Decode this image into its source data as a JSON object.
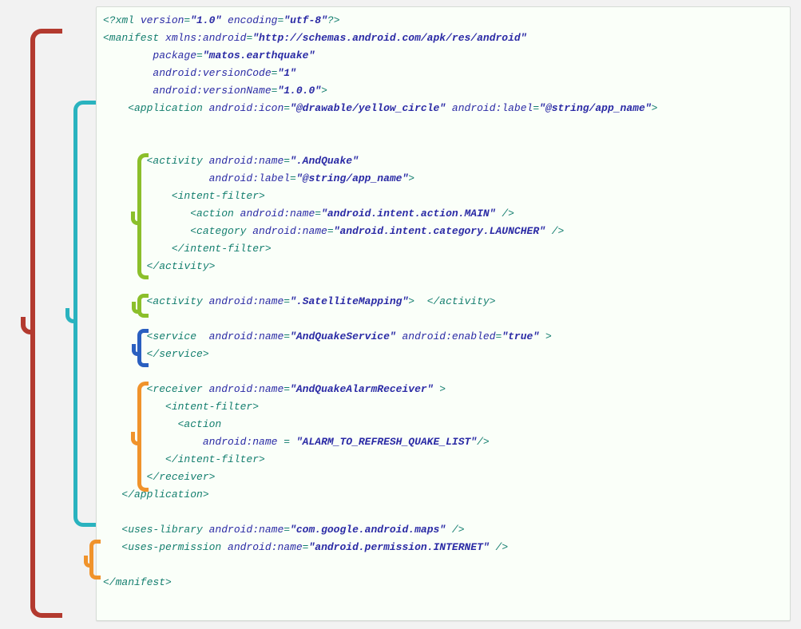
{
  "code": {
    "l01a": "<?xml ",
    "l01b": "version",
    "l01c": "=",
    "l01d": "\"1.0\"",
    "l01e": " encoding",
    "l01f": "=",
    "l01g": "\"utf-8\"",
    "l01h": "?>",
    "l02a": "<manifest ",
    "l02b": "xmlns:android",
    "l02c": "=",
    "l02d": "\"http://schemas.android.com/apk/res/android\"",
    "l03a": "        package",
    "l03b": "=",
    "l03c": "\"matos.earthquake\"",
    "l04a": "        android:versionCode",
    "l04b": "=",
    "l04c": "\"1\"",
    "l05a": "        android:versionName",
    "l05b": "=",
    "l05c": "\"1.0.0\"",
    "l05d": ">",
    "l06a": "    <application ",
    "l06b": "android:icon",
    "l06c": "=",
    "l06d": "\"@drawable/yellow_circle\"",
    "l06e": " android:label",
    "l06f": "=",
    "l06g": "\"@string/app_name\"",
    "l06h": ">",
    "l07blank": "",
    "l08blank": "",
    "l09a": "       <activity ",
    "l09b": "android:name",
    "l09c": "=",
    "l09d": "\".AndQuake\"",
    "l10a": "                 android:label",
    "l10b": "=",
    "l10c": "\"@string/app_name\"",
    "l10d": ">",
    "l11a": "           <intent-filter>",
    "l12a": "              <action ",
    "l12b": "android:name",
    "l12c": "=",
    "l12d": "\"android.intent.action.MAIN\"",
    "l12e": " />",
    "l13a": "              <category ",
    "l13b": "android:name",
    "l13c": "=",
    "l13d": "\"android.intent.category.LAUNCHER\"",
    "l13e": " />",
    "l14a": "           </intent-filter>",
    "l15a": "       </activity>",
    "l16blank": "",
    "l17a": "       <activity ",
    "l17b": "android:name",
    "l17c": "=",
    "l17d": "\".SatelliteMapping\"",
    "l17e": ">  </activity>",
    "l18blank": "",
    "l19a": "       <service  ",
    "l19b": "android:name",
    "l19c": "=",
    "l19d": "\"AndQuakeService\"",
    "l19e": " android:enabled",
    "l19f": "=",
    "l19g": "\"true\"",
    "l19h": " >",
    "l20a": "       </service>",
    "l21blank": "",
    "l22a": "       <receiver ",
    "l22b": "android:name",
    "l22c": "=",
    "l22d": "\"AndQuakeAlarmReceiver\"",
    "l22e": " >",
    "l23a": "          <intent-filter>",
    "l24a": "            <action",
    "l25a": "                android:name ",
    "l25b": "= ",
    "l25c": "\"ALARM_TO_REFRESH_QUAKE_LIST\"",
    "l25d": "/>",
    "l26a": "          </intent-filter>",
    "l27a": "       </receiver>",
    "l28a": "   </application>",
    "l29blank": "",
    "l30a": "   <uses-library ",
    "l30b": "android:name",
    "l30c": "=",
    "l30d": "\"com.google.android.maps\"",
    "l30e": " />",
    "l31a": "   <uses-permission ",
    "l31b": "android:name",
    "l31c": "=",
    "l31d": "\"android.permission.INTERNET\"",
    "l31e": " />",
    "l32blank": "",
    "l33a": "</manifest>"
  },
  "braces": {
    "manifest": "manifest-brace",
    "application": "application-brace",
    "activity1": "activity-one-brace",
    "activity2": "activity-two-brace",
    "service": "service-brace",
    "receiver": "receiver-brace",
    "uses": "uses-brace"
  }
}
